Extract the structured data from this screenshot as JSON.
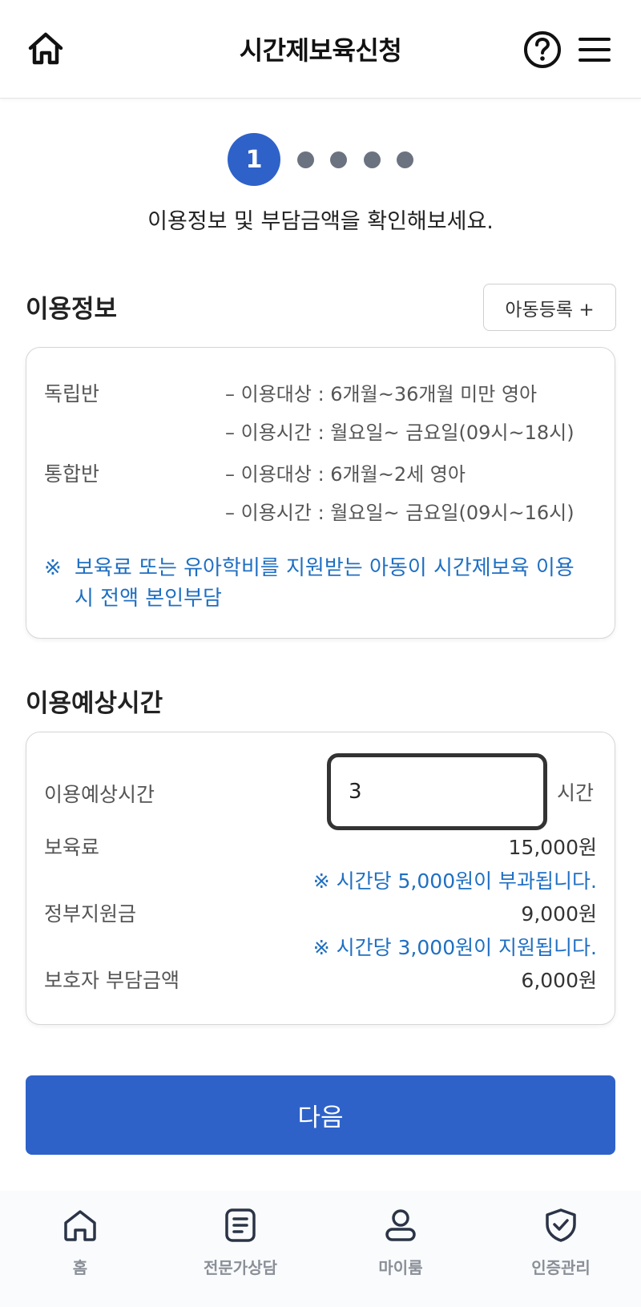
{
  "header": {
    "title": "시간제보육신청"
  },
  "steps": {
    "current": "1",
    "total": 5
  },
  "subtitle": "이용정보 및 부담금액을 확인해보세요.",
  "info_section": {
    "title": "이용정보",
    "register_button": "아동등록 +",
    "classes": [
      {
        "name": "독립반",
        "lines": [
          "–  이용대상 : 6개월~36개월 미만 영아",
          "–  이용시간 : 월요일~ 금요일(09시~18시)"
        ]
      },
      {
        "name": "통합반",
        "lines": [
          "–  이용대상 : 6개월~2세 영아",
          "–  이용시간 : 월요일~ 금요일(09시~16시)"
        ]
      }
    ],
    "notice_mark": "※",
    "notice": "보육료 또는 유아학비를 지원받는 아동이 시간제보육 이용시 전액 본인부담"
  },
  "time_section": {
    "title": "이용예상시간",
    "hours_label": "이용예상시간",
    "hours_value": "3",
    "hours_unit": "시간",
    "fee_label": "보육료",
    "fee_value": "15,000원",
    "fee_note": "※  시간당 5,000원이 부과됩니다.",
    "subsidy_label": "정부지원금",
    "subsidy_value": "9,000원",
    "subsidy_note": "※  시간당 3,000원이 지원됩니다.",
    "guardian_label": "보호자 부담금액",
    "guardian_value": "6,000원"
  },
  "next_button": "다음",
  "bottom_nav": [
    {
      "label": "홈",
      "icon": "home-icon"
    },
    {
      "label": "전문가상담",
      "icon": "document-icon"
    },
    {
      "label": "마이룸",
      "icon": "person-icon"
    },
    {
      "label": "인증관리",
      "icon": "shield-check-icon"
    }
  ],
  "colors": {
    "primary": "#2e62c9",
    "notice": "#1f6fc2",
    "inactive_dot": "#6b7280"
  }
}
